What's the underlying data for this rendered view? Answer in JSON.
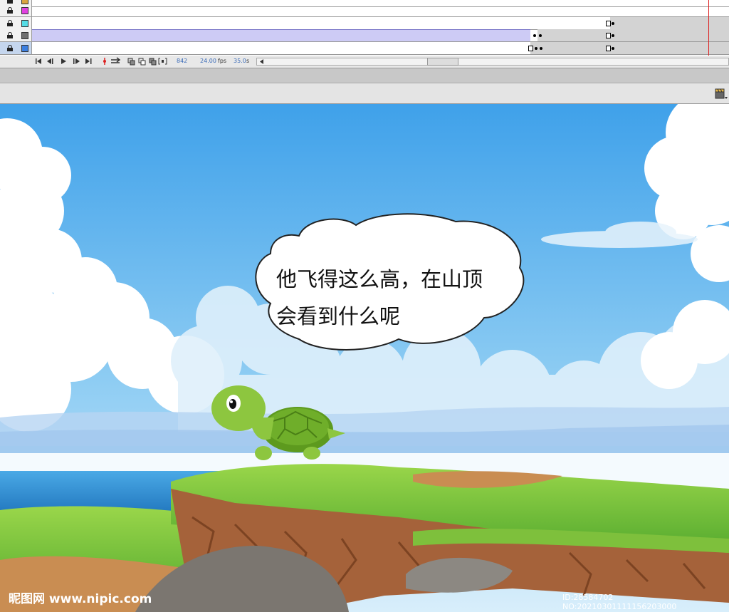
{
  "timeline": {
    "layers": [
      {
        "color": "#d9a441"
      },
      {
        "color": "#e040e0"
      },
      {
        "color": "#55dde6"
      },
      {
        "color": "#707070"
      },
      {
        "color": "#3b7fe0"
      }
    ],
    "current_frame": "842",
    "fps": "24.00",
    "fps_unit": "fps",
    "time": "35.0",
    "time_unit": "s"
  },
  "stage": {
    "bubble_text": "他飞得这么高，在山顶\n会看到什么呢",
    "watermark_left": "昵图网 www.nipic.com",
    "watermark_right": "ID:28584702 NO:20210301111156203000"
  },
  "icons": [
    "lock-icon",
    "first-frame-icon",
    "prev-frame-icon",
    "play-icon",
    "next-frame-icon",
    "last-frame-icon",
    "center-frame-icon",
    "loop-icon",
    "onion-skin-icon",
    "onion-outline-icon",
    "edit-multiple-icon",
    "modify-markers-icon",
    "scroll-left-icon",
    "clapperboard-icon"
  ]
}
